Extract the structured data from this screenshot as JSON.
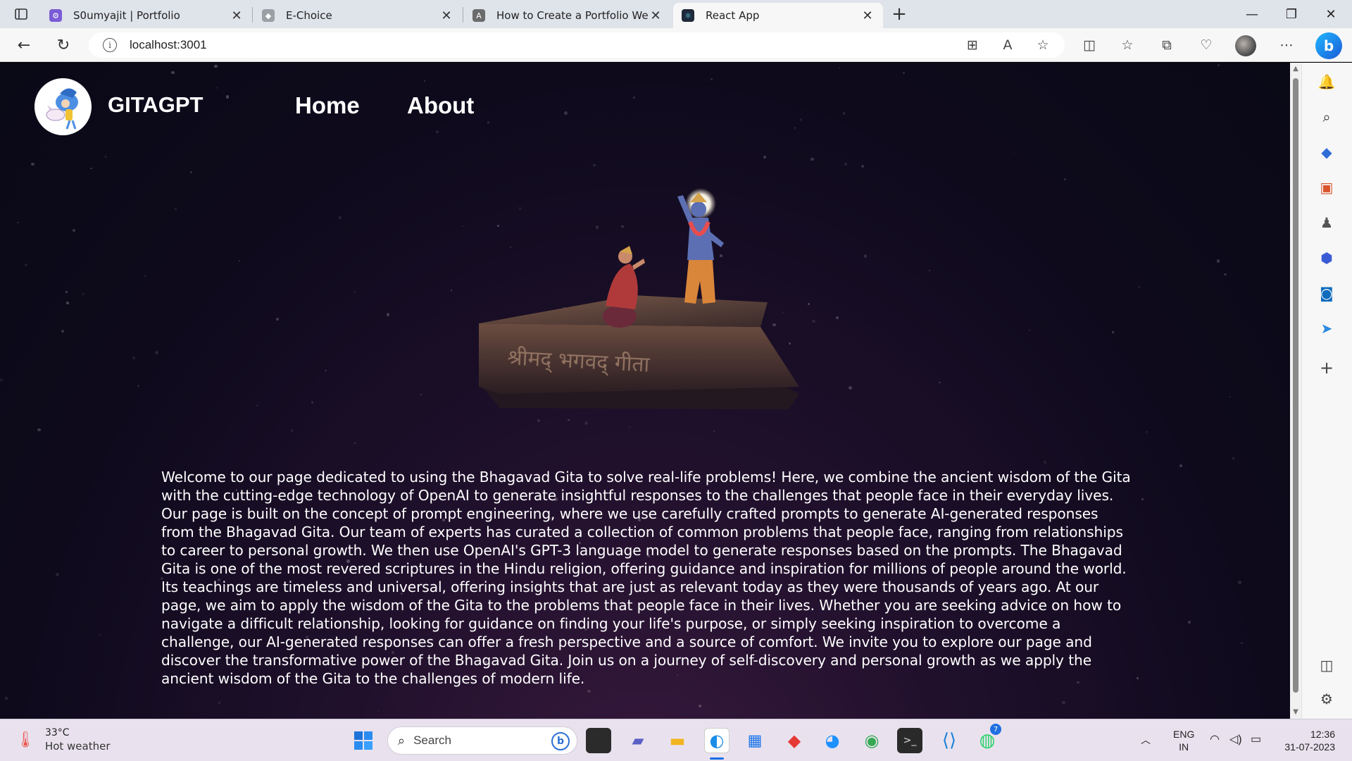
{
  "browser": {
    "tabs": [
      {
        "title": "S0umyajit | Portfolio",
        "active": false
      },
      {
        "title": "E-Choice",
        "active": false
      },
      {
        "title": "How to Create a Portfolio Websit",
        "active": false
      },
      {
        "title": "React App",
        "active": true
      }
    ],
    "url": "localhost:3001"
  },
  "site": {
    "brand": "GITAGPT",
    "nav": [
      "Home",
      "About"
    ],
    "hero_book_text": "श्रीमद् भगवद् गीता",
    "intro": "Welcome to our page dedicated to using the Bhagavad Gita to solve real-life problems! Here, we combine the ancient wisdom of the Gita with the cutting-edge technology of OpenAI to generate insightful responses to the challenges that people face in their everyday lives. Our page is built on the concept of prompt engineering, where we use carefully crafted prompts to generate AI-generated responses from the Bhagavad Gita. Our team of experts has curated a collection of common problems that people face, ranging from relationships to career to personal growth. We then use OpenAI's GPT-3 language model to generate responses based on the prompts. The Bhagavad Gita is one of the most revered scriptures in the Hindu religion, offering guidance and inspiration for millions of people around the world. Its teachings are timeless and universal, offering insights that are just as relevant today as they were thousands of years ago. At our page, we aim to apply the wisdom of the Gita to the problems that people face in their lives. Whether you are seeking advice on how to navigate a difficult relationship, looking for guidance on finding your life's purpose, or simply seeking inspiration to overcome a challenge, our AI-generated responses can offer a fresh perspective and a source of comfort. We invite you to explore our page and discover the transformative power of the Bhagavad Gita. Join us on a journey of self-discovery and personal growth as we apply the ancient wisdom of the Gita to the challenges of modern life."
  },
  "taskbar": {
    "weather_temp": "33°C",
    "weather_desc": "Hot weather",
    "search_label": "Search",
    "lang_top": "ENG",
    "lang_bottom": "IN",
    "time": "12:36",
    "date": "31-07-2023",
    "whatsapp_badge": "7"
  },
  "colors": {
    "page_bg": "#0e0a1c",
    "text": "#ffffff",
    "taskbar_bg": "#e9e2ee"
  }
}
